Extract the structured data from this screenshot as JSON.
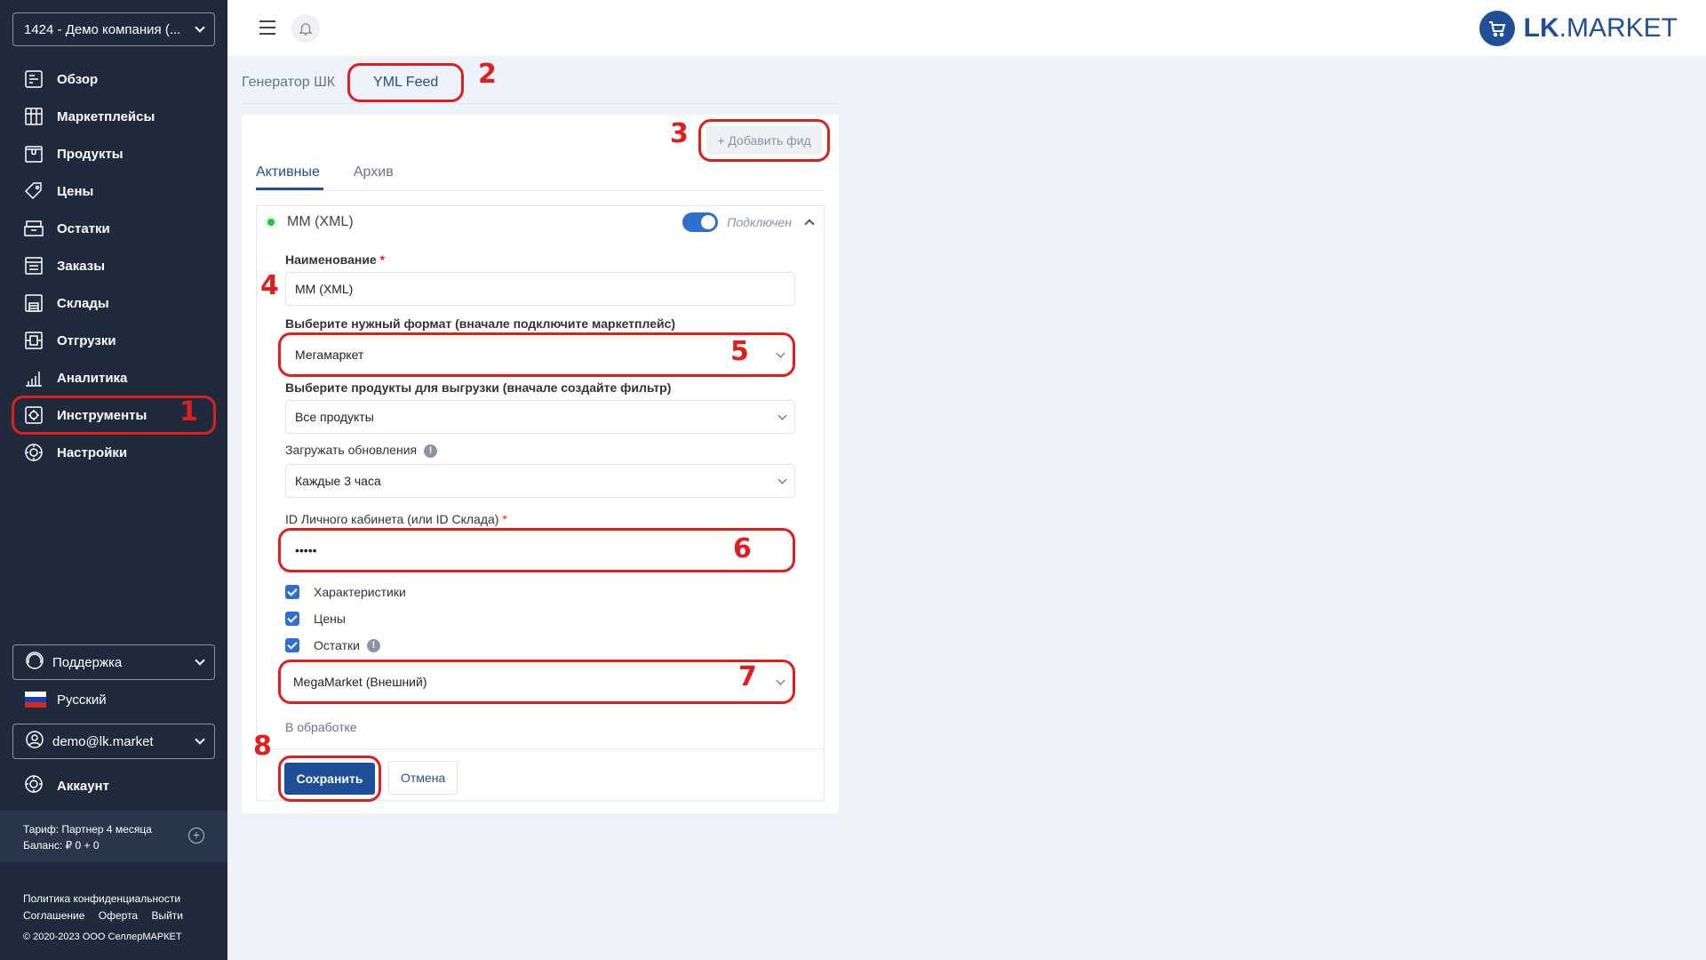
{
  "sidebar": {
    "company": "1424 - Демо компания (...",
    "items": [
      {
        "label": "Обзор",
        "icon": "overview-icon"
      },
      {
        "label": "Маркетплейсы",
        "icon": "marketplaces-icon"
      },
      {
        "label": "Продукты",
        "icon": "products-icon"
      },
      {
        "label": "Цены",
        "icon": "prices-icon"
      },
      {
        "label": "Остатки",
        "icon": "stock-icon"
      },
      {
        "label": "Заказы",
        "icon": "orders-icon"
      },
      {
        "label": "Склады",
        "icon": "warehouses-icon"
      },
      {
        "label": "Отгрузки",
        "icon": "shipments-icon"
      },
      {
        "label": "Аналитика",
        "icon": "analytics-icon"
      },
      {
        "label": "Инструменты",
        "icon": "tools-icon"
      },
      {
        "label": "Настройки",
        "icon": "settings-icon"
      }
    ],
    "support": "Поддержка",
    "language": "Русский",
    "user": "demo@lk.market",
    "account": "Аккаунт",
    "tariff": "Тариф: Партнер 4 месяца",
    "balance": "Баланс: ₽ 0 + 0",
    "footer": {
      "privacy": "Политика конфиденциальности",
      "agreement": "Соглашение",
      "offer": "Оферта",
      "logout": "Выйти",
      "copyright": "© 2020-2023 ООО СеллерМАРКЕТ"
    }
  },
  "header": {
    "logo_bold": "LK",
    "logo_rest": ".MARKET"
  },
  "top_tabs": [
    {
      "label": "Генератор ШК"
    },
    {
      "label": "YML Feed"
    }
  ],
  "card": {
    "add_feed": "+ Добавить фид",
    "tabs": [
      {
        "label": "Активные"
      },
      {
        "label": "Архив"
      }
    ],
    "feed": {
      "title": "MM (XML)",
      "toggle_label": "Подключен",
      "name_label": "Наименование",
      "name_value": "MM (XML)",
      "format_label": "Выберите нужный формат (вначале подключите маркетплейс)",
      "format_value": "Мегамаркет",
      "products_label": "Выберите продукты для выгрузки (вначале создайте фильтр)",
      "products_value": "Все продукты",
      "updates_label": "Загружать обновления",
      "updates_value": "Каждые 3 часа",
      "cabinet_label": "ID Личного кабинета (или ID Склада)",
      "cabinet_value": "•••••",
      "checkboxes": [
        {
          "label": "Характеристики"
        },
        {
          "label": "Цены"
        },
        {
          "label": "Остатки"
        }
      ],
      "warehouse_value": "MegaMarket (Внешний)",
      "status": "В обработке",
      "save": "Сохранить",
      "cancel": "Отмена"
    }
  },
  "annotations": [
    "1",
    "2",
    "3",
    "4",
    "5",
    "6",
    "7",
    "8"
  ],
  "colors": {
    "accent": "#1f4f96",
    "sidebar": "#1f2a3c",
    "annotation": "#e01e1e",
    "online": "#2bbf4a"
  }
}
